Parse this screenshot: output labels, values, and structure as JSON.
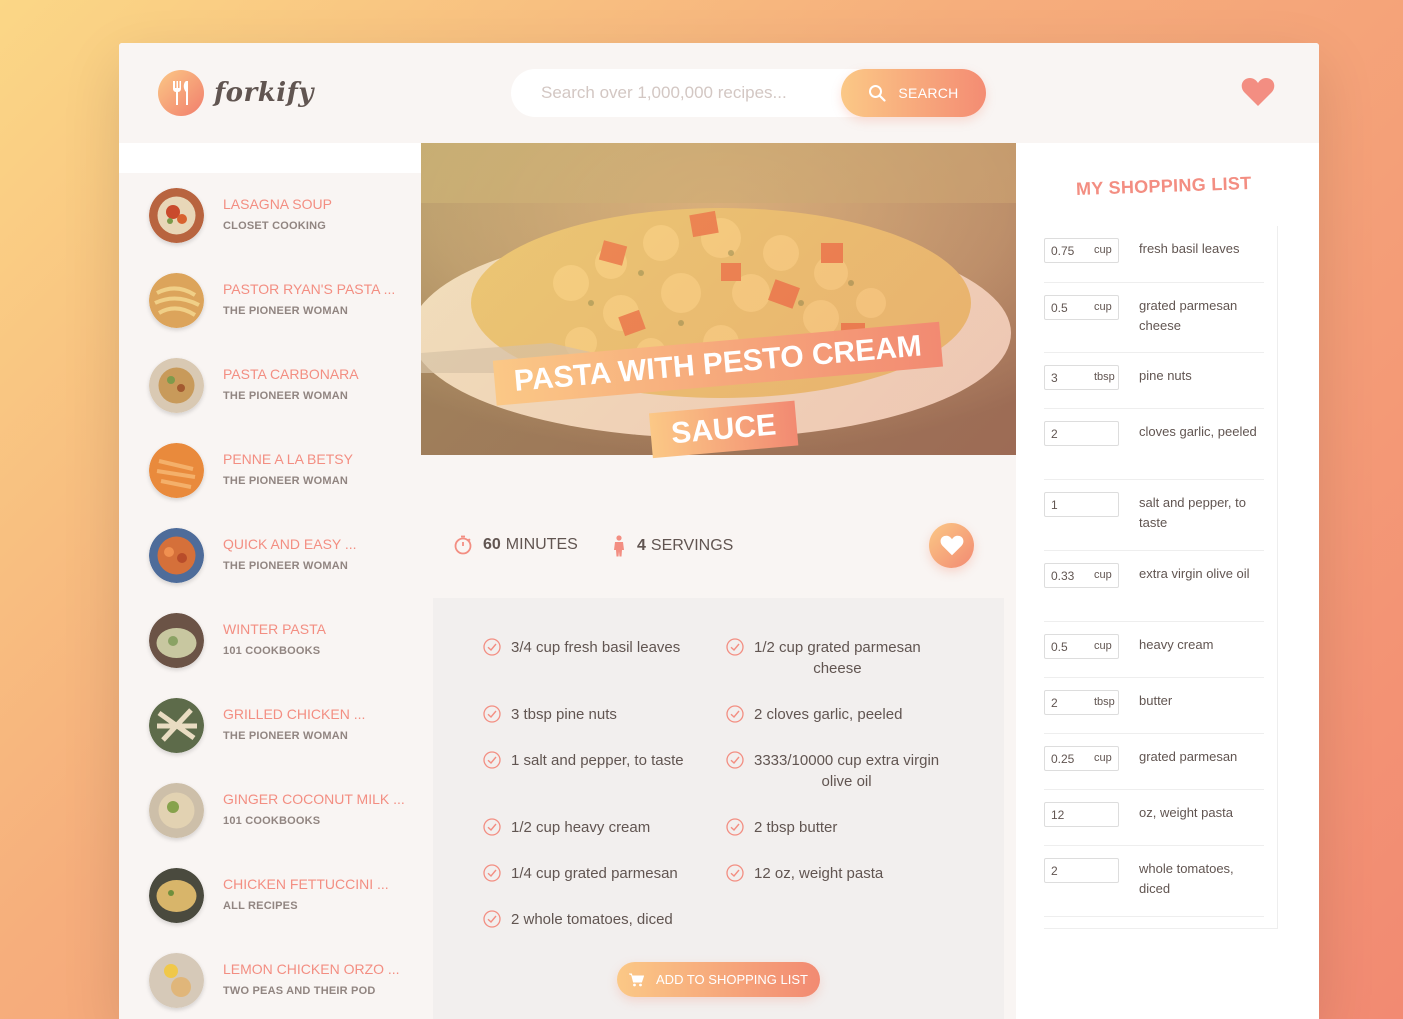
{
  "header": {
    "logo_text": "forkify",
    "search_placeholder": "Search over 1,000,000 recipes...",
    "search_button": "SEARCH"
  },
  "results": [
    {
      "title": "LASAGNA SOUP",
      "author": "CLOSET COOKING"
    },
    {
      "title": "PASTOR RYAN'S PASTA ...",
      "author": "THE PIONEER WOMAN"
    },
    {
      "title": "PASTA CARBONARA",
      "author": "THE PIONEER WOMAN"
    },
    {
      "title": "PENNE A LA BETSY",
      "author": "THE PIONEER WOMAN"
    },
    {
      "title": "QUICK AND EASY ...",
      "author": "THE PIONEER WOMAN"
    },
    {
      "title": "WINTER PASTA",
      "author": "101 COOKBOOKS"
    },
    {
      "title": "GRILLED CHICKEN ...",
      "author": "THE PIONEER WOMAN"
    },
    {
      "title": "GINGER COCONUT MILK ...",
      "author": "101 COOKBOOKS"
    },
    {
      "title": "CHICKEN FETTUCCINI ...",
      "author": "ALL RECIPES"
    },
    {
      "title": "LEMON CHICKEN ORZO ...",
      "author": "TWO PEAS AND THEIR POD"
    }
  ],
  "recipe": {
    "title_line1": "PASTA WITH PESTO CREAM",
    "title_line2": "SAUCE",
    "minutes_value": "60",
    "minutes_label": "MINUTES",
    "servings_value": "4",
    "servings_label": "SERVINGS",
    "ingredients": [
      {
        "text": "3/4 cup fresh basil leaves"
      },
      {
        "text": "1/2 cup grated parmesan",
        "text2": "cheese"
      },
      {
        "text": "3 tbsp pine nuts"
      },
      {
        "text": "2 cloves garlic, peeled"
      },
      {
        "text": "1 salt and pepper, to taste"
      },
      {
        "text": "3333/10000 cup extra virgin",
        "text2": "olive oil"
      },
      {
        "text": "1/2 cup heavy cream"
      },
      {
        "text": "2 tbsp butter"
      },
      {
        "text": "1/4 cup grated parmesan"
      },
      {
        "text": "12 oz, weight pasta"
      },
      {
        "text": "2 whole tomatoes, diced"
      }
    ],
    "add_button": "ADD TO SHOPPING LIST"
  },
  "shopping": {
    "title": "MY SHOPPING LIST",
    "items": [
      {
        "value": "0.75",
        "unit": "cup",
        "desc": "fresh basil leaves"
      },
      {
        "value": "0.5",
        "unit": "cup",
        "desc": "grated parmesan cheese"
      },
      {
        "value": "3",
        "unit": "tbsp",
        "desc": "pine nuts"
      },
      {
        "value": "2",
        "unit": "",
        "desc": "cloves garlic, peeled"
      },
      {
        "value": "1",
        "unit": "",
        "desc": "salt and pepper, to taste"
      },
      {
        "value": "0.33",
        "unit": "cup",
        "desc": "extra virgin olive oil"
      },
      {
        "value": "0.5",
        "unit": "cup",
        "desc": "heavy cream"
      },
      {
        "value": "2",
        "unit": "tbsp",
        "desc": "butter"
      },
      {
        "value": "0.25",
        "unit": "cup",
        "desc": "grated parmesan"
      },
      {
        "value": "12",
        "unit": "",
        "desc": "oz, weight pasta"
      },
      {
        "value": "2",
        "unit": "",
        "desc": "whole tomatoes, diced"
      }
    ]
  },
  "colors": {
    "accent": "#f38e82",
    "gradient_start": "#fbc886",
    "gradient_end": "#f28a72",
    "text": "#615551"
  }
}
